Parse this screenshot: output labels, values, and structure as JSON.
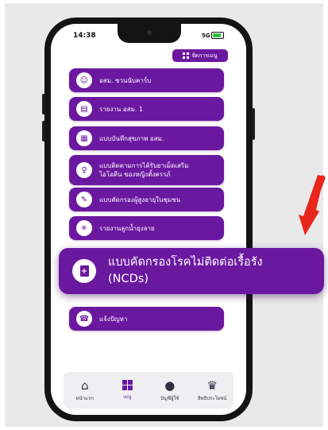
{
  "status_bar": {
    "time": "14:38",
    "network": "5G",
    "battery_level": 0.8
  },
  "header": {
    "manage_menu_label": "จัดการเมนู",
    "manage_menu_icon": "grid-icon"
  },
  "menu": {
    "items": [
      {
        "label": "อสม. ชวนนับคาร์บ",
        "icon": "carb-counter-icon"
      },
      {
        "label": "รายงาน อสม. 1",
        "icon": "document-icon"
      },
      {
        "label": "แบบบันทึกสุขภาพ อสม.",
        "icon": "health-record-icon"
      },
      {
        "label": "แบบติดตามการได้รับยาเม็ดเสริม\nไอโอดีน ของหญิงตั้งครรภ์",
        "icon": "pregnant-woman-icon"
      },
      {
        "label": "แบบคัดกรองผู้สูงอายุในชุมชน",
        "icon": "elderly-screening-icon"
      },
      {
        "label": "รายงานลูกน้ำยุงลาย",
        "icon": "mosquito-icon"
      },
      {
        "label": "แจ้งปัญหา",
        "icon": "support-headset-icon"
      }
    ]
  },
  "highlight": {
    "label": "แบบคัดกรองโรคไม่ติดต่อเรื้อรัง\n(NCDs)",
    "icon": "medical-document-icon",
    "arrow_color": "#e8261c"
  },
  "tabbar": {
    "tabs": [
      {
        "label": "หน้าแรก",
        "icon": "home-icon",
        "active": false
      },
      {
        "label": "เมนู",
        "icon": "grid-icon",
        "active": true
      },
      {
        "label": "บัญชีผู้ใช้",
        "icon": "user-icon",
        "active": false
      },
      {
        "label": "สิทธิประโยชน์",
        "icon": "award-icon",
        "active": false
      }
    ]
  },
  "colors": {
    "accent": "#6b18a0",
    "background": "#e9e9ea",
    "arrow": "#e8261c"
  }
}
